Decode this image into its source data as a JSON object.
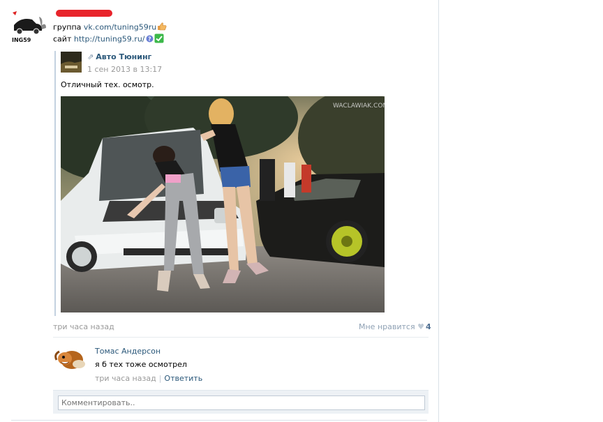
{
  "post": {
    "group_prefix": "группа ",
    "group_link": "vk.com/tuning59ru",
    "site_prefix": "сайт ",
    "site_link": "http://tuning59.ru/",
    "avatar_text": "ING59",
    "time": "три часа назад",
    "like_label": "Мне нравится",
    "like_count": "4"
  },
  "repost": {
    "author": "Авто Тюнинг",
    "date": "1 сен 2013 в 13:17",
    "text": "Отличный тех. осмотр.",
    "photo_watermark": "WACLAWIAK.COM"
  },
  "comment": {
    "author": "Томас Андерсон",
    "text": "я б тех тоже осмотрел",
    "time": "три часа назад",
    "reply_label": "Ответить"
  },
  "comment_box": {
    "placeholder": "Комментировать.."
  },
  "colors": {
    "link": "#2b587a",
    "muted": "#999999",
    "redacted": "#e8242b"
  }
}
